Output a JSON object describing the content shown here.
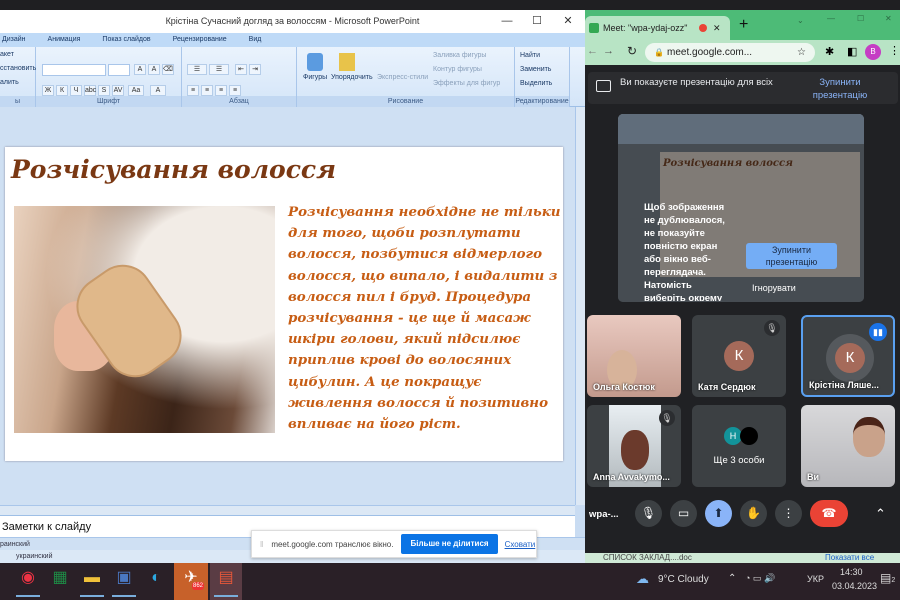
{
  "ppt": {
    "title": "Крістіна Сучасний догляд за волоссям - Microsoft PowerPoint",
    "tabs": [
      "Дизайн",
      "Анимация",
      "Показ слайдов",
      "Рецензирование",
      "Вид"
    ],
    "ribbon": {
      "slides_items": [
        "акет",
        "сстановить",
        "алить"
      ],
      "slides_group": "ы",
      "font_group": "Шрифт",
      "font_buttons": [
        "Ж",
        "К",
        "Ч",
        "abc",
        "S",
        "AV",
        "Aa",
        "A"
      ],
      "paragraph_group": "Абзац",
      "drawing_group": "Рисование",
      "shapes": "Фигуры",
      "arrange": "Упорядочить",
      "quick_styles": "Экспресс-стили",
      "shape_fill": "Заливка фигуры",
      "shape_outline": "Контур фигуры",
      "shape_effects": "Эффекты для фигур",
      "editing_group": "Редактирование",
      "find": "Найти",
      "replace": "Заменить",
      "select": "Выделить"
    },
    "slide": {
      "title": "Розчісування волосся",
      "body_lines": [
        "Розчісування необхідне не тільки",
        "для того, щоби розплутати",
        "волосся, позбутися відмерлого",
        "волосся, що випало, і видалити з",
        "волосся пил і бруд. Процедура",
        "розчісування - це ще й масаж",
        "шкіри голови, який підсилює",
        "приплив крові до волосяних",
        "цибулин. А це покращує",
        "живлення волосся й позитивно",
        "впливає на його ріст."
      ]
    },
    "notes_placeholder": "Заметки к слайду",
    "status_lang1": "раинский",
    "status_lang2": "украинский"
  },
  "sharebar": {
    "text": "meet.google.com транслює вікно.",
    "stop": "Більше не ділитися",
    "hide": "Сховати"
  },
  "chrome": {
    "tab_title": "Meet: \"wpa-ydaj-ozz\"",
    "url": "meet.google.com...",
    "profile": "B"
  },
  "meet": {
    "banner_text": "Ви показуєте презентацію для всіх",
    "banner_stop": "Зупинити презентацію",
    "preview_slide_title": "Розчісування волосся",
    "preview_message": "Щоб зображення не дублювалося, не показуйте повністю екран або вікно веб-переглядача. Натомість виберіть окрему",
    "preview_stop": "Зупинити презентацію",
    "preview_ignore": "Ігнорувати",
    "participants": [
      {
        "name": "Ольга Костюк"
      },
      {
        "name": "Катя Сердюк",
        "initial": "К"
      },
      {
        "name": "Крістіна Ляше...",
        "initial": "К"
      },
      {
        "name": "Anna Avvakymo..."
      },
      {
        "name": "Ще 3 особи",
        "initial": "Н"
      },
      {
        "name": "Ви"
      }
    ],
    "meeting_code": "wpa-...",
    "accent": "#8ab4f8",
    "end_call_color": "#ea4335"
  },
  "downloads": {
    "file": "СПИСОК ЗАКЛАД....doc",
    "show_all": "Показати все"
  },
  "taskbar": {
    "telegram_badge": "862",
    "weather": "9°C  Cloudy",
    "lang": "УКР",
    "time": "14:30",
    "date": "03.04.2023",
    "notifications": "2"
  }
}
